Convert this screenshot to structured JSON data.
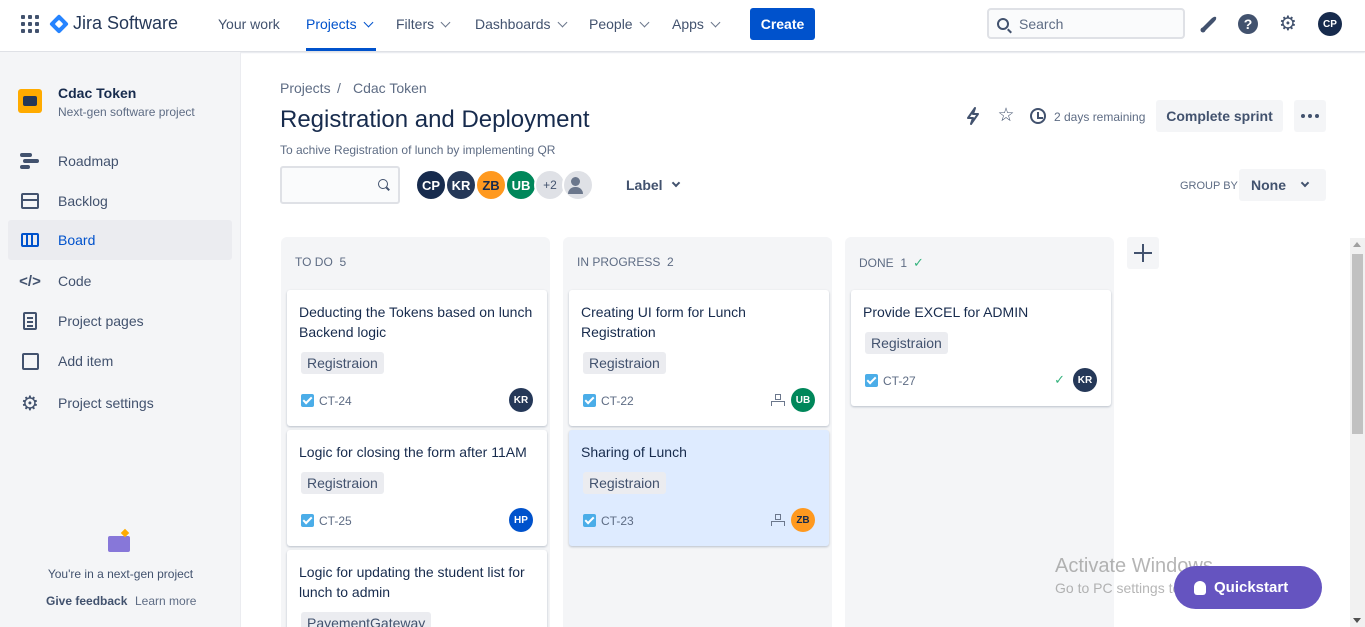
{
  "nav": {
    "brand": "Jira Software",
    "items": [
      "Your work",
      "Projects",
      "Filters",
      "Dashboards",
      "People",
      "Apps"
    ],
    "create_label": "Create",
    "search_placeholder": "Search",
    "profile_initials": "CP"
  },
  "sidebar": {
    "project_name": "Cdac Token",
    "project_type": "Next-gen software project",
    "items": [
      "Roadmap",
      "Backlog",
      "Board",
      "Code",
      "Project pages",
      "Add item",
      "Project settings"
    ],
    "nextgen_text": "You're in a next-gen project",
    "feedback": "Give feedback",
    "learn_more": "Learn more"
  },
  "header": {
    "breadcrumb": [
      "Projects",
      "Cdac Token"
    ],
    "breadcrumb_sep": "/",
    "title": "Registration and Deployment",
    "subtitle": "To achive Registration of lunch by implementing QR",
    "remaining": "2 days remaining",
    "complete_sprint": "Complete sprint"
  },
  "filters": {
    "avatars": [
      {
        "initials": "CP",
        "color": "#172B4D"
      },
      {
        "initials": "KR",
        "color": "#253858"
      },
      {
        "initials": "ZB",
        "color": "#FF991F"
      },
      {
        "initials": "UB",
        "color": "#00875A"
      }
    ],
    "more_count": "+2",
    "label_dropdown": "Label",
    "group_by_label": "GROUP BY",
    "group_by_value": "None"
  },
  "columns": [
    {
      "name": "TO DO",
      "count": "5",
      "cards": [
        {
          "title": "Deducting the Tokens based on lunch Backend logic",
          "tag": "Registraion",
          "key": "CT-24",
          "assignee": "KR",
          "color": "#253858"
        },
        {
          "title": "Logic for closing the form after 11AM",
          "tag": "Registraion",
          "key": "CT-25",
          "assignee": "HP",
          "color": "#0052CC"
        },
        {
          "title": "Logic for updating the student list for lunch to admin",
          "tag": "PayementGateway"
        }
      ]
    },
    {
      "name": "IN PROGRESS",
      "count": "2",
      "cards": [
        {
          "title": "Creating UI form for Lunch Registration",
          "tag": "Registraion",
          "key": "CT-22",
          "assignee": "UB",
          "color": "#00875A"
        },
        {
          "title": "Sharing of Lunch",
          "tag": "Registraion",
          "key": "CT-23",
          "assignee": "ZB",
          "color": "#FF991F"
        }
      ]
    },
    {
      "name": "DONE",
      "count": "1",
      "cards": [
        {
          "title": "Provide EXCEL for ADMIN",
          "tag": "Registraion",
          "key": "CT-27",
          "assignee": "KR",
          "color": "#253858"
        }
      ]
    }
  ],
  "overlay": {
    "watermark_title": "Activate Windows",
    "watermark_sub": "Go to PC settings to activate Windows.",
    "quickstart": "Quickstart"
  }
}
